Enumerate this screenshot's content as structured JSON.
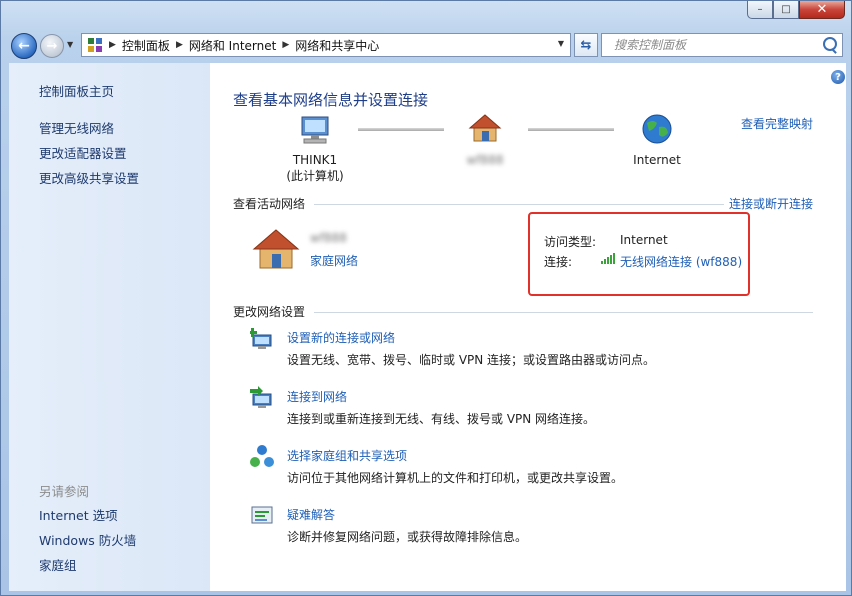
{
  "window": {
    "caption_buttons": {
      "minimize": "–",
      "maximize": "□",
      "close": "✕"
    }
  },
  "navbar": {
    "breadcrumbs": [
      "控制面板",
      "网络和 Internet",
      "网络和共享中心"
    ],
    "search_placeholder": "搜索控制面板"
  },
  "sidebar": {
    "items": [
      {
        "label": "控制面板主页"
      },
      {
        "label": "管理无线网络"
      },
      {
        "label": "更改适配器设置"
      },
      {
        "label": "更改高级共享设置"
      }
    ],
    "see_also_heading": "另请参阅",
    "see_also": [
      {
        "label": "Internet 选项"
      },
      {
        "label": "Windows 防火墙"
      },
      {
        "label": "家庭组"
      }
    ]
  },
  "main": {
    "title": "查看基本网络信息并设置连接",
    "full_map_link": "查看完整映射",
    "map": {
      "computer_name": "THINK1",
      "computer_sub": "(此计算机)",
      "network_name": "wf888",
      "internet_label": "Internet"
    },
    "active_networks": {
      "heading": "查看活动网络",
      "connect_link": "连接或断开连接",
      "network_name": "wf888",
      "network_type": "家庭网络",
      "access_type_label": "访问类型:",
      "access_type_value": "Internet",
      "connection_label": "连接:",
      "connection_value": "无线网络连接 (wf888)"
    },
    "change_settings": {
      "heading": "更改网络设置",
      "tasks": [
        {
          "title": "设置新的连接或网络",
          "desc": "设置无线、宽带、拨号、临时或 VPN 连接；或设置路由器或访问点。"
        },
        {
          "title": "连接到网络",
          "desc": "连接到或重新连接到无线、有线、拨号或 VPN 网络连接。"
        },
        {
          "title": "选择家庭组和共享选项",
          "desc": "访问位于其他网络计算机上的文件和打印机，或更改共享设置。"
        },
        {
          "title": "疑难解答",
          "desc": "诊断并修复网络问题，或获得故障排除信息。"
        }
      ]
    }
  }
}
